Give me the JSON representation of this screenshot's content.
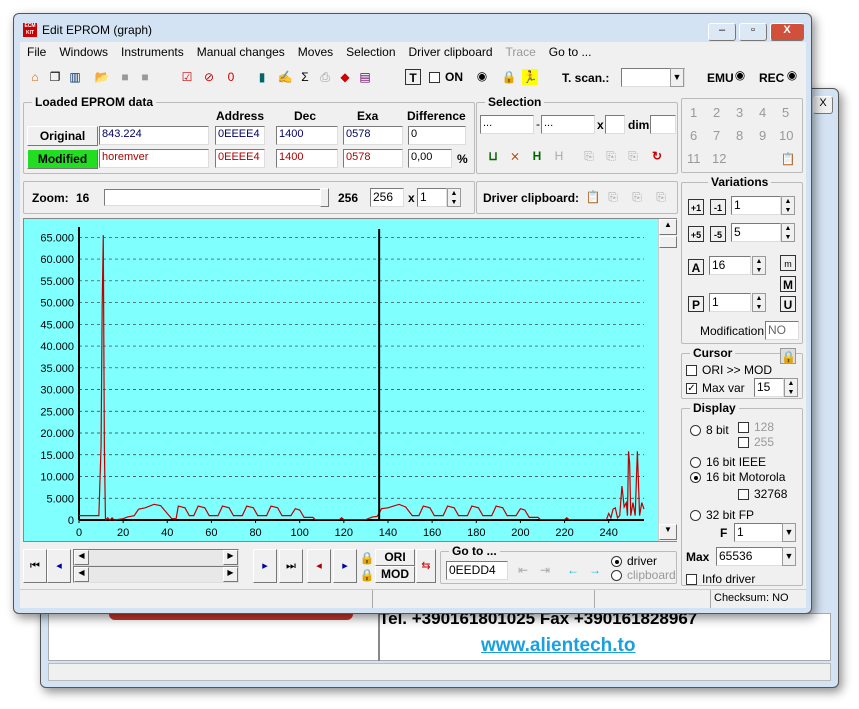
{
  "back_window": {
    "phone_text": "Tel. +390161801025 Fax +390161828967",
    "website": "www.alientech.to",
    "close_label": "X"
  },
  "window": {
    "title": "Edit EPROM (graph)",
    "logo": "ECM KIT"
  },
  "menu": [
    "File",
    "Windows",
    "Instruments",
    "Manual changes",
    "Moves",
    "Selection",
    "Driver clipboard",
    "Trace",
    "Go to ..."
  ],
  "toolbar": {
    "on_label": "ON",
    "tscan_label": "T. scan.:",
    "tscan_value": "",
    "emu_label": "EMU",
    "rec_label": "REC"
  },
  "loaded": {
    "title": "Loaded EPROM data",
    "headers": [
      "Address",
      "Dec",
      "Exa",
      "Difference"
    ],
    "original": {
      "label": "Original",
      "name": "843.224",
      "address": "0EEEE4",
      "dec": "1400",
      "exa": "0578",
      "difference": "0"
    },
    "modified": {
      "label": "Modified",
      "name": "horemver",
      "address": "0EEEE4",
      "dec": "1400",
      "exa": "0578",
      "difference": "0,00",
      "unit": "%"
    }
  },
  "selection": {
    "title": "Selection",
    "from": "...",
    "to": "...",
    "x_label": "x",
    "dim_label": "dim.",
    "x_value": "",
    "dim_value": ""
  },
  "numbers": [
    "1",
    "2",
    "3",
    "4",
    "5",
    "6",
    "7",
    "8",
    "9",
    "10",
    "11",
    "12"
  ],
  "zoom": {
    "label": "Zoom:",
    "min": "16",
    "max": "256",
    "value": "256",
    "x_label": "x",
    "multiplier": "1"
  },
  "driver_clipboard": {
    "label": "Driver clipboard:"
  },
  "variations": {
    "title": "Variations",
    "step1": "1",
    "step5": "5",
    "a_value": "16",
    "p_value": "1",
    "modification_label": "Modification",
    "modification_value": "NO"
  },
  "cursor": {
    "title": "Cursor",
    "ori_mod_label": "ORI >> MOD",
    "ori_mod_checked": false,
    "max_var_label": "Max var",
    "max_var_checked": true,
    "max_var_value": "15"
  },
  "display": {
    "title": "Display",
    "bit8": "8 bit",
    "v128": "128",
    "v255": "255",
    "ieee": "16 bit IEEE",
    "motorola": "16 bit Motorola",
    "selected": "16 bit Motorola",
    "v32768": "32768",
    "fp32": "32 bit FP",
    "f_label": "F",
    "f_value": "1",
    "max_label": "Max",
    "max_value": "65536",
    "info_driver": "Info driver"
  },
  "nav": {
    "ori_label": "ORI",
    "mod_label": "MOD",
    "goto_title": "Go to ...",
    "goto_value": "0EEDD4",
    "driver_label": "driver",
    "clipboard_label": "clipboard",
    "radio_selected": "driver"
  },
  "status": {
    "checksum": "Checksum: NO"
  },
  "colors": {
    "chart_bg": "#80ffff",
    "line": "#c00000",
    "modified_bg": "#22dd22",
    "cursor_line": "#000000"
  },
  "chart_data": {
    "type": "line",
    "xlim": [
      0,
      256
    ],
    "ylim": [
      0,
      65535
    ],
    "x_ticks": [
      0,
      20,
      40,
      60,
      80,
      100,
      120,
      140,
      160,
      180,
      200,
      220,
      240
    ],
    "y_ticks": [
      0,
      5000,
      10000,
      15000,
      20000,
      25000,
      30000,
      35000,
      40000,
      45000,
      50000,
      55000,
      60000,
      65000
    ],
    "y_tick_labels": [
      "0",
      "5.000",
      "10.000",
      "15.000",
      "20.000",
      "25.000",
      "30.000",
      "35.000",
      "40.000",
      "45.000",
      "50.000",
      "55.000",
      "60.000",
      "65.000"
    ],
    "grid": "horizontal dashed",
    "cursor_x": 136,
    "points": [
      [
        0,
        1000
      ],
      [
        9,
        1000
      ],
      [
        10,
        17000
      ],
      [
        10.5,
        49000
      ],
      [
        11,
        65500
      ],
      [
        11.5,
        16500
      ],
      [
        12,
        0
      ],
      [
        13,
        500
      ],
      [
        14,
        0
      ],
      [
        15,
        500
      ],
      [
        16,
        0
      ],
      [
        20,
        300
      ],
      [
        22,
        700
      ],
      [
        25,
        1000
      ],
      [
        27,
        2500
      ],
      [
        30,
        2800
      ],
      [
        34,
        3600
      ],
      [
        37,
        3300
      ],
      [
        40,
        1500
      ],
      [
        42,
        300
      ],
      [
        44,
        300
      ],
      [
        45,
        3200
      ],
      [
        48,
        2800
      ],
      [
        50,
        1000
      ],
      [
        52,
        1000
      ],
      [
        54,
        3200
      ],
      [
        57,
        2800
      ],
      [
        59,
        1000
      ],
      [
        63,
        1000
      ],
      [
        65,
        3200
      ],
      [
        68,
        2800
      ],
      [
        70,
        1000
      ],
      [
        74,
        1000
      ],
      [
        76,
        3200
      ],
      [
        79,
        2800
      ],
      [
        81,
        1000
      ],
      [
        85,
        1000
      ],
      [
        87,
        3200
      ],
      [
        90,
        2800
      ],
      [
        92,
        1000
      ],
      [
        96,
        1000
      ],
      [
        98,
        2600
      ],
      [
        100,
        2300
      ],
      [
        102,
        600
      ],
      [
        106,
        600
      ],
      [
        107,
        100
      ],
      [
        118,
        100
      ],
      [
        119,
        500
      ],
      [
        120,
        100
      ],
      [
        130,
        100
      ],
      [
        133,
        700
      ],
      [
        135,
        800
      ],
      [
        136,
        1500
      ],
      [
        137,
        2600
      ],
      [
        140,
        2800
      ],
      [
        145,
        3600
      ],
      [
        148,
        3000
      ],
      [
        151,
        1000
      ],
      [
        154,
        1000
      ],
      [
        156,
        3200
      ],
      [
        159,
        2800
      ],
      [
        161,
        1000
      ],
      [
        165,
        1000
      ],
      [
        167,
        3200
      ],
      [
        170,
        2800
      ],
      [
        172,
        1000
      ],
      [
        176,
        1000
      ],
      [
        178,
        3200
      ],
      [
        181,
        2800
      ],
      [
        183,
        1000
      ],
      [
        187,
        1000
      ],
      [
        189,
        3200
      ],
      [
        192,
        2800
      ],
      [
        194,
        1000
      ],
      [
        198,
        1000
      ],
      [
        200,
        2600
      ],
      [
        202,
        2300
      ],
      [
        204,
        600
      ],
      [
        208,
        600
      ],
      [
        209,
        100
      ],
      [
        220,
        100
      ],
      [
        221,
        500
      ],
      [
        222,
        100
      ],
      [
        239,
        100
      ],
      [
        240,
        1500
      ],
      [
        241,
        500
      ],
      [
        242,
        2500
      ],
      [
        243,
        2800
      ],
      [
        244,
        500
      ],
      [
        245,
        1000
      ],
      [
        246,
        7800
      ],
      [
        247,
        3000
      ],
      [
        248,
        4000
      ],
      [
        248.5,
        1000
      ],
      [
        249,
        15800
      ],
      [
        249.5,
        13000
      ],
      [
        250,
        1000
      ],
      [
        251,
        4000
      ],
      [
        252,
        1000
      ],
      [
        253,
        15800
      ],
      [
        254,
        1000
      ],
      [
        255,
        4000
      ],
      [
        256,
        2500
      ]
    ]
  }
}
